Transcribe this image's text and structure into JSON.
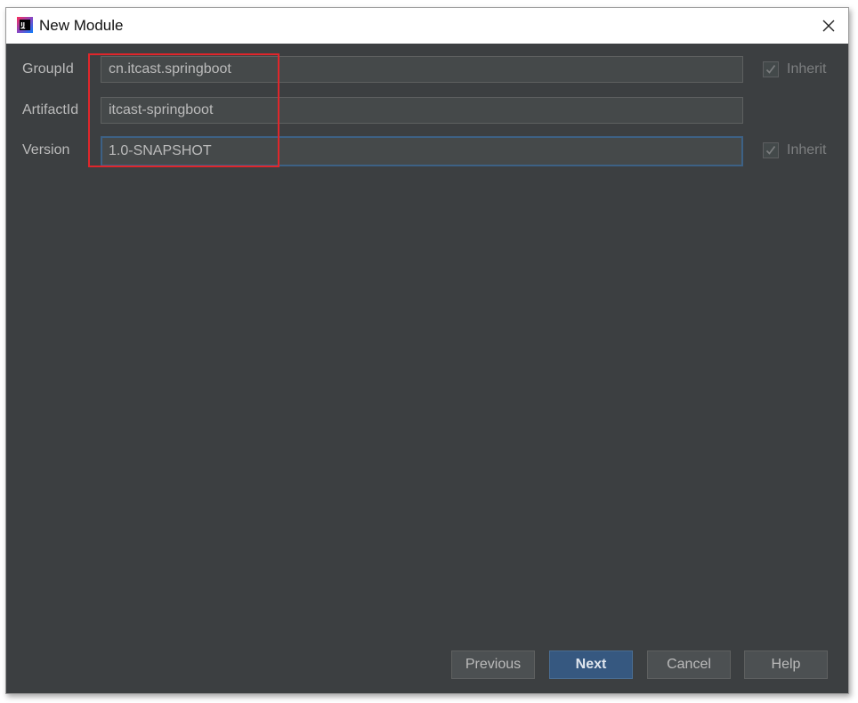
{
  "window": {
    "title": "New Module",
    "app_icon": "intellij-idea-icon",
    "close_icon": "close-icon"
  },
  "form": {
    "groupid": {
      "label": "GroupId",
      "value": "cn.itcast.springboot",
      "inherit_label": "Inherit",
      "inherit_checked": true
    },
    "artifactid": {
      "label": "ArtifactId",
      "value": "itcast-springboot"
    },
    "version": {
      "label": "Version",
      "value": "1.0-SNAPSHOT",
      "inherit_label": "Inherit",
      "inherit_checked": true
    }
  },
  "buttons": {
    "previous": "Previous",
    "next": "Next",
    "cancel": "Cancel",
    "help": "Help"
  },
  "colors": {
    "background": "#3c3f41",
    "primary_button": "#365880",
    "annotation_box": "#e0262b",
    "focus_border": "#3d6185"
  }
}
